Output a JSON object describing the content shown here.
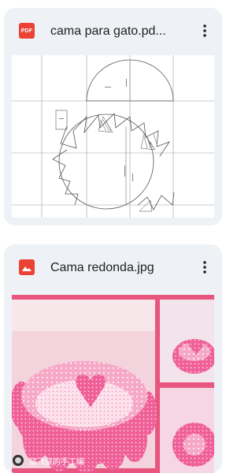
{
  "files": [
    {
      "name": "cama para gato.pdf",
      "display_name": "cama para gato.pd...",
      "type_badge": "PDF",
      "type": "pdf",
      "icon": "pdf-icon",
      "accent": "#ea4335"
    },
    {
      "name": "Cama redonda.jpg",
      "display_name": "Cama redonda.jpg",
      "type": "image",
      "icon": "image-icon",
      "accent": "#ea4335",
      "watermark": "鼠飞鼠的手工编"
    }
  ],
  "menu_icon": "more-vert-icon"
}
